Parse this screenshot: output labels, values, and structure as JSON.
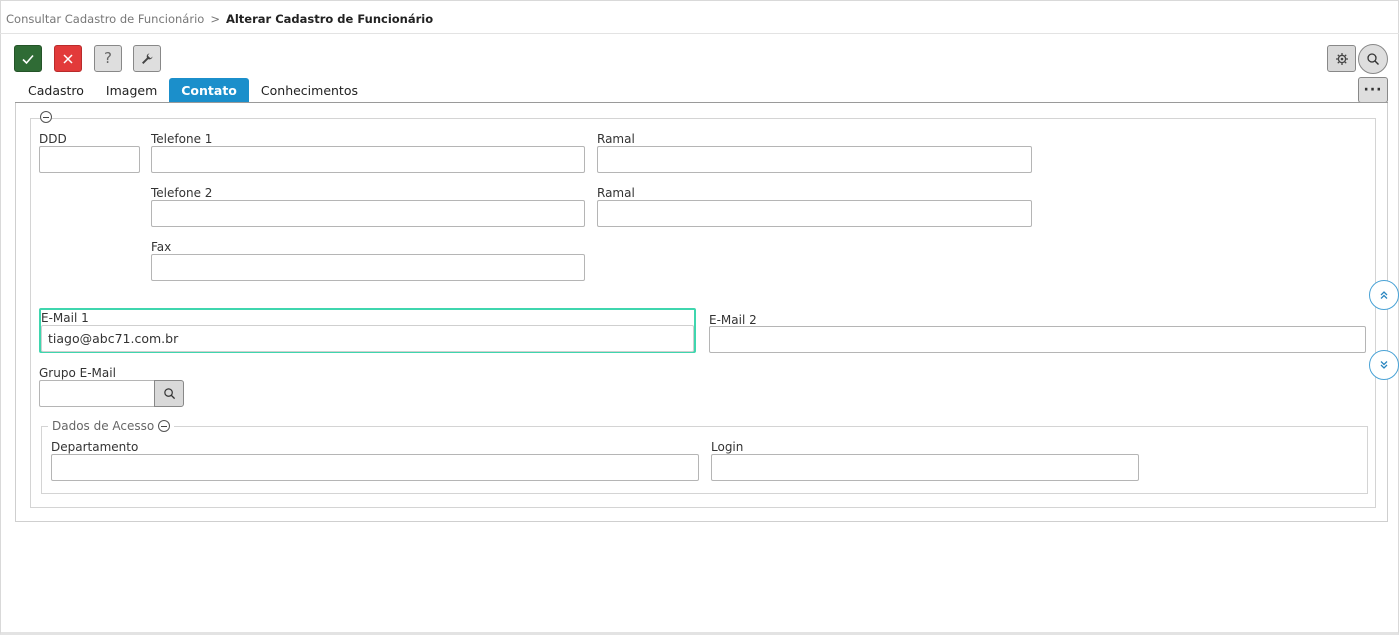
{
  "breadcrumb": {
    "parent": "Consultar Cadastro de Funcionário",
    "separator": ">",
    "current": "Alterar Cadastro de Funcionário"
  },
  "toolbar": {
    "confirm_icon": "check-icon",
    "cancel_icon": "close-icon",
    "help_label": "?",
    "tools_icon": "wrench-icon",
    "settings_icon": "gear-icon",
    "search_icon": "search-icon",
    "more_label": "···"
  },
  "tabs": [
    {
      "label": "Cadastro",
      "active": false
    },
    {
      "label": "Imagem",
      "active": false
    },
    {
      "label": "Contato",
      "active": true
    },
    {
      "label": "Conhecimentos",
      "active": false
    }
  ],
  "form": {
    "ddd": {
      "label": "DDD",
      "value": ""
    },
    "telefone1": {
      "label": "Telefone 1",
      "value": ""
    },
    "ramal1": {
      "label": "Ramal",
      "value": ""
    },
    "telefone2": {
      "label": "Telefone 2",
      "value": ""
    },
    "ramal2": {
      "label": "Ramal",
      "value": ""
    },
    "fax": {
      "label": "Fax",
      "value": ""
    },
    "email1": {
      "label": "E-Mail 1",
      "value": "tiago@abc71.com.br"
    },
    "email2": {
      "label": "E-Mail 2",
      "value": ""
    },
    "grupo_email": {
      "label": "Grupo E-Mail",
      "value": ""
    }
  },
  "acesso": {
    "legend": "Dados de Acesso",
    "departamento": {
      "label": "Departamento",
      "value": ""
    },
    "login": {
      "label": "Login",
      "value": ""
    }
  },
  "colors": {
    "confirm": "#2f6b35",
    "cancel": "#e23a3a",
    "active_tab": "#1b8fcb",
    "focus_border": "#3fd6ae"
  }
}
